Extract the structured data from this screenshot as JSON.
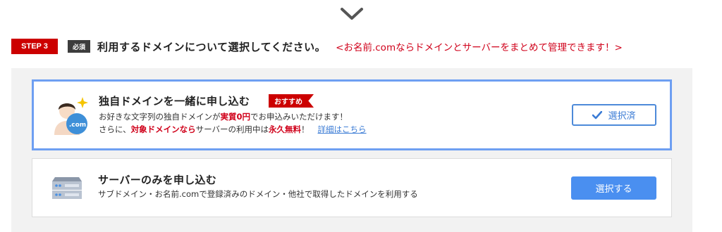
{
  "step": {
    "badge": "STEP 3",
    "required": "必須",
    "title": "利用するドメインについて選択してください。",
    "note": "<お名前.comならドメインとサーバーをまとめて管理できます！>"
  },
  "options": {
    "domain": {
      "icon": "person-dotcom-icon",
      "title": "独自ドメインを一緒に申し込む",
      "badge": "おすすめ",
      "desc1_a": "お好きな文字列の独自ドメインが",
      "desc1_b": "実質0円",
      "desc1_c": "でお申込みいただけます！",
      "desc2_a": "さらに、",
      "desc2_b": "対象ドメインなら",
      "desc2_c": "サーバーの利用中は",
      "desc2_d": "永久無料",
      "desc2_e": "！",
      "link": "詳細はこちら",
      "button": "選択済",
      "avatar_text": ".com"
    },
    "server": {
      "icon": "server-icon",
      "title": "サーバーのみを申し込む",
      "desc": "サブドメイン・お名前.comで登録済みのドメイン・他社で取得したドメインを利用する",
      "button": "選択する"
    }
  },
  "colors": {
    "accent_red": "#cc0000",
    "accent_blue": "#4a8ff0",
    "selected_border": "#6e9ff2"
  }
}
